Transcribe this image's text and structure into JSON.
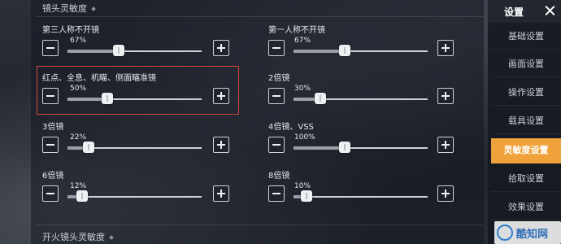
{
  "sections": {
    "scope_sensitivity": "镜头灵敏度",
    "fire_scope_sensitivity": "开火镜头灵敏度"
  },
  "settings": [
    {
      "label": "第三人称不开镜",
      "value": "67%",
      "level": 67
    },
    {
      "label": "第一人称不开镜",
      "value": "67%",
      "level": 67
    },
    {
      "label": "红点、全息、机瞄、侧面瞄准镜",
      "value": "50%",
      "level": 50
    },
    {
      "label": "2倍镜",
      "value": "30%",
      "level": 30
    },
    {
      "label": "3倍镜",
      "value": "22%",
      "level": 22
    },
    {
      "label": "4倍镜、VSS",
      "value": "100%",
      "level": 100
    },
    {
      "label": "6倍镜",
      "value": "12%",
      "level": 12
    },
    {
      "label": "8倍镜",
      "value": "10%",
      "level": 10
    }
  ],
  "sidebar": {
    "title": "设置",
    "items": [
      {
        "label": "基础设置"
      },
      {
        "label": "画面设置"
      },
      {
        "label": "操作设置"
      },
      {
        "label": "载具设置"
      },
      {
        "label": "灵敏度设置",
        "active": true
      },
      {
        "label": "拾取设置"
      },
      {
        "label": "效果设置"
      }
    ]
  },
  "watermark": {
    "text": "酷知网"
  },
  "colors": {
    "accent": "#f0a23a",
    "highlight": "#d6453a"
  }
}
